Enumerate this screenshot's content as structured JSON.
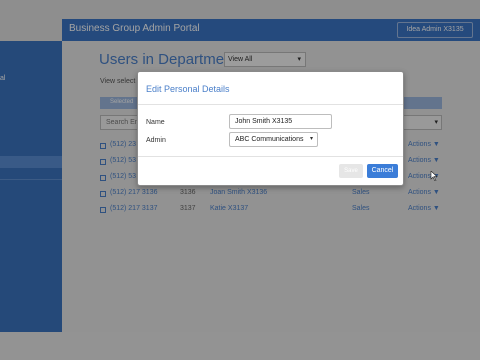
{
  "app": {
    "title": "Business Group Admin Portal",
    "user_button": "Idea Admin X3135"
  },
  "sidebar": {
    "link": "al"
  },
  "main": {
    "heading": "Users in Department:",
    "view_select": "View All",
    "view_hint": "View select",
    "tab_label": "Selected",
    "search_placeholder": "Search Em"
  },
  "rows": [
    {
      "phone": "(512) 23",
      "ext": "",
      "name": "",
      "dept": "",
      "action": "Actions ▼"
    },
    {
      "phone": "(512) 53",
      "ext": "",
      "name": "",
      "dept": "",
      "action": "Actions ▼"
    },
    {
      "phone": "(512) 53",
      "ext": "",
      "name": "",
      "dept": "",
      "action": "Actions ▼"
    },
    {
      "phone": "(512) 217 3136",
      "ext": "3136",
      "name": "Joan Smith X3136",
      "dept": "Sales",
      "action": "Actions ▼"
    },
    {
      "phone": "(512) 217 3137",
      "ext": "3137",
      "name": "Katie X3137",
      "dept": "Sales",
      "action": "Actions ▼"
    }
  ],
  "modal": {
    "title": "Edit Personal Details",
    "name_label": "Name",
    "name_value": "John Smith X3135",
    "admin_label": "Admin",
    "admin_value": "ABC Communications",
    "save_label": "Save",
    "cancel_label": "Cancel"
  },
  "colors": {
    "accent": "#3b72bd",
    "modal_title": "#4a7fc9",
    "primary_button": "#3b7dd8"
  }
}
